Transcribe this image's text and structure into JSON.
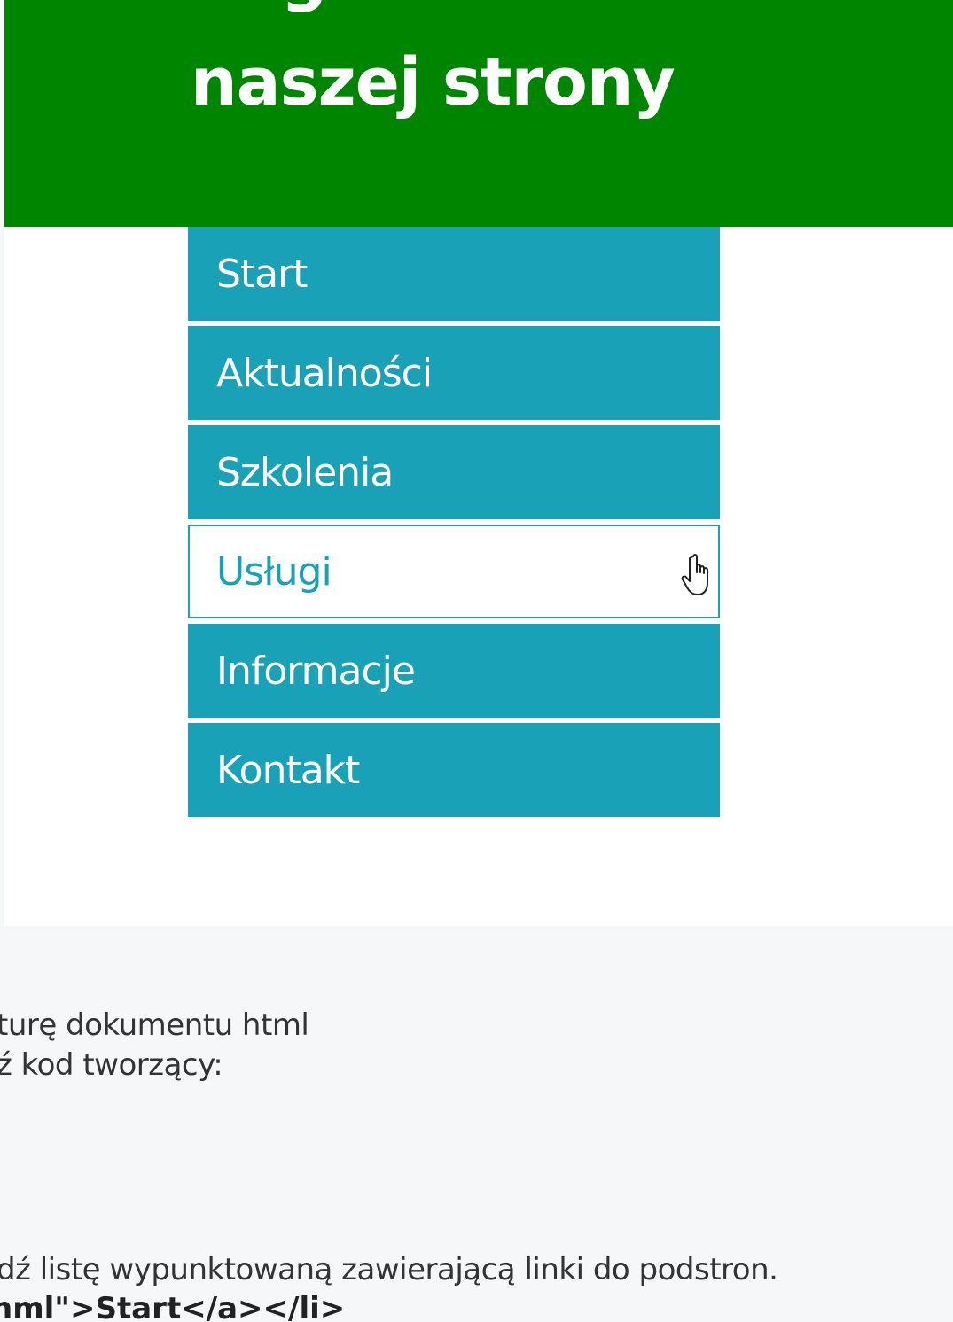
{
  "header": {
    "line1": "Zagi.........",
    "line2": "naszej strony",
    "background_color": "#008500"
  },
  "menu": {
    "accent_color": "#19a1b8",
    "hovered_index": 3,
    "items": [
      {
        "label": "Start"
      },
      {
        "label": "Aktualności"
      },
      {
        "label": "Szkolenia"
      },
      {
        "label": "Usługi"
      },
      {
        "label": "Informacje"
      },
      {
        "label": "Kontakt"
      }
    ]
  },
  "content": {
    "line1": "turę dokumentu html",
    "line2": "ź kod tworzący:",
    "line3": "dź listę wypunktowaną zawierającą linki do podstron.",
    "code_line": "hml\">Start</a></li>"
  }
}
